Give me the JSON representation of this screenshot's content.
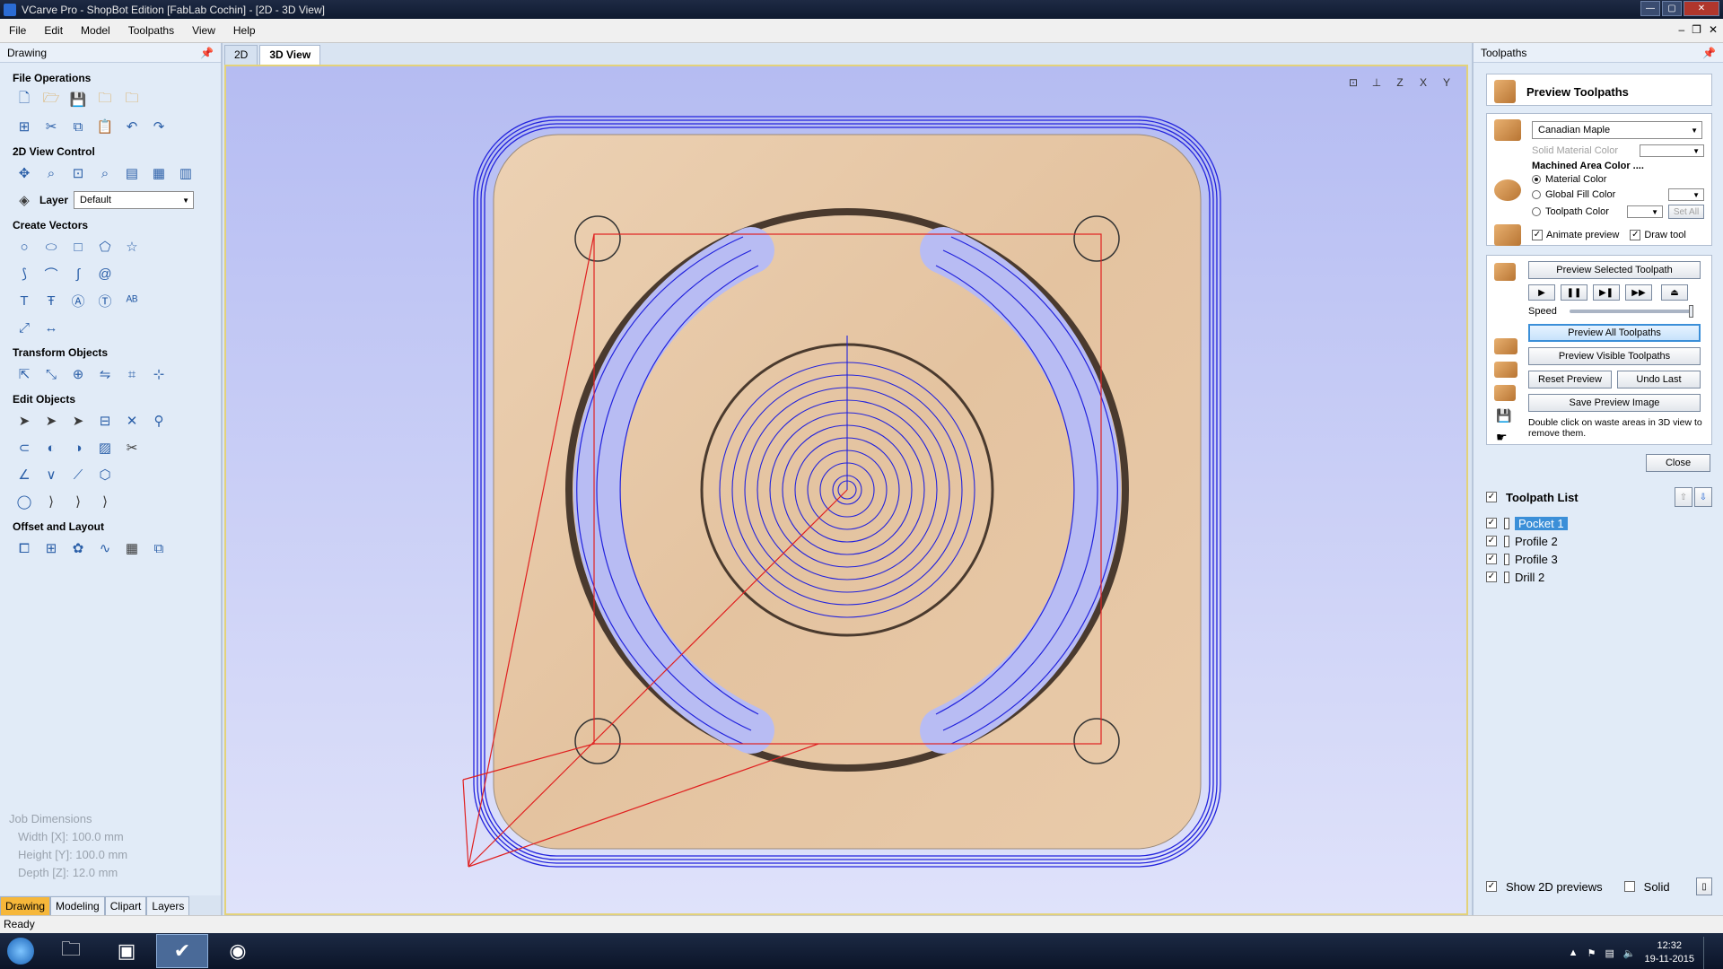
{
  "window": {
    "title": "VCarve Pro - ShopBot Edition [FabLab Cochin] - [2D - 3D View]"
  },
  "menubar": {
    "items": [
      "File",
      "Edit",
      "Model",
      "Toolpaths",
      "View",
      "Help"
    ]
  },
  "left_panel": {
    "header": "Drawing",
    "sections": {
      "file_operations": "File Operations",
      "view_control": "2D View Control",
      "create_vectors": "Create Vectors",
      "transform_objects": "Transform Objects",
      "edit_objects": "Edit Objects",
      "offset_layout": "Offset and Layout"
    },
    "layer_label": "Layer",
    "layer_value": "Default",
    "job_dimensions": {
      "title": "Job Dimensions",
      "width": "Width  [X]: 100.0 mm",
      "height": "Height [Y]: 100.0 mm",
      "depth": "Depth  [Z]: 12.0 mm"
    },
    "tabs": [
      "Drawing",
      "Modeling",
      "Clipart",
      "Layers"
    ],
    "active_tab": "Drawing"
  },
  "view_tabs": [
    "2D",
    "3D View"
  ],
  "active_view_tab": "3D View",
  "right_panel": {
    "header": "Toolpaths",
    "preview_title": "Preview Toolpaths",
    "material": "Canadian Maple",
    "solid_material_color": "Solid Material Color",
    "machined_area_color": "Machined Area Color ....",
    "radio_material": "Material Color",
    "radio_global": "Global Fill Color",
    "radio_toolpath": "Toolpath Color",
    "set_all": "Set All",
    "animate_preview": "Animate preview",
    "draw_tool": "Draw tool",
    "preview_selected": "Preview Selected Toolpath",
    "speed_label": "Speed",
    "preview_all": "Preview All Toolpaths",
    "preview_visible": "Preview Visible Toolpaths",
    "reset_preview": "Reset Preview",
    "undo_last": "Undo Last",
    "save_preview": "Save Preview Image",
    "hint": "Double click on waste areas in 3D view to remove them.",
    "close": "Close",
    "toolpath_list_title": "Toolpath List",
    "toolpaths": [
      {
        "name": "Pocket 1",
        "checked": true,
        "selected": true
      },
      {
        "name": "Profile 2",
        "checked": true,
        "selected": false
      },
      {
        "name": "Profile 3",
        "checked": true,
        "selected": false
      },
      {
        "name": "Drill 2",
        "checked": true,
        "selected": false
      }
    ],
    "show_2d_previews": "Show 2D previews",
    "solid": "Solid"
  },
  "status": "Ready",
  "taskbar": {
    "time": "12:32",
    "date": "19-11-2015"
  },
  "colors": {
    "viewport_top": "#b5bcf2",
    "toolpath_blue": "#2222dd",
    "bounding_red": "#e02020",
    "wood": "#e6c6a4",
    "active_tab": "#f6b73a"
  }
}
